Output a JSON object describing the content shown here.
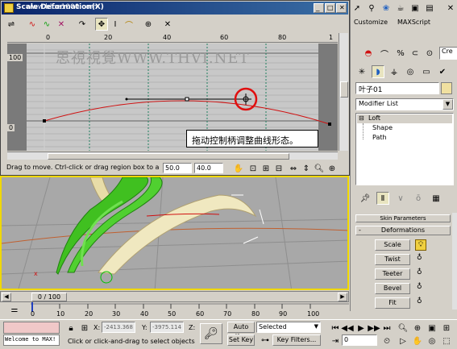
{
  "watermark": "www.blue1000.com",
  "deform_window": {
    "title": "Scale Deformation(X)",
    "ruler_ticks": [
      "0",
      "20",
      "40",
      "60",
      "80",
      "1"
    ],
    "y_labels": [
      "100",
      "0"
    ],
    "graph_watermark": "思視視覺WWW.THVI.NET",
    "callout": "拖动控制柄调整曲线形态。",
    "status_hint": "Drag to move. Ctrl-click or drag region box to add to s",
    "field1": "50.0",
    "field2": "40.0"
  },
  "cmd_panel": {
    "tab_customize": "Customize",
    "tab_maxscript": "MAXScript",
    "name_field": "叶子01",
    "modifier_list": "Modifier List",
    "stack": [
      "Loft",
      "Shape",
      "Path"
    ],
    "rollout_skin": "Skin Parameters",
    "rollout_deform": "Deformations",
    "deform_buttons": [
      "Scale",
      "Twist",
      "Teeter",
      "Bevel",
      "Fit"
    ]
  },
  "timeline": {
    "frame_label": "0 / 100",
    "ticks": [
      "0",
      "10",
      "20",
      "30",
      "40",
      "50",
      "60",
      "70",
      "80",
      "90",
      "100"
    ]
  },
  "status": {
    "maxscript": "Welcome to MAX!",
    "x_label": "X:",
    "x_value": "-2413.368",
    "y_label": "Y:",
    "y_value": "-3975.114",
    "z_label": "Z:",
    "prompt": "Click or click-and-drag to select objects",
    "auto_key": "Auto Key",
    "set_key": "Set Key",
    "selected": "Selected",
    "key_filters": "Key Filters...",
    "frame_spinner": "0"
  },
  "colors": {
    "accent": "#0a246a",
    "curve": "#d01010",
    "callout_circle": "#e01010",
    "viewport_bg": "#a8a8a8",
    "green_leaf": "#40c020",
    "cream_leaf": "#f0e8c0"
  }
}
